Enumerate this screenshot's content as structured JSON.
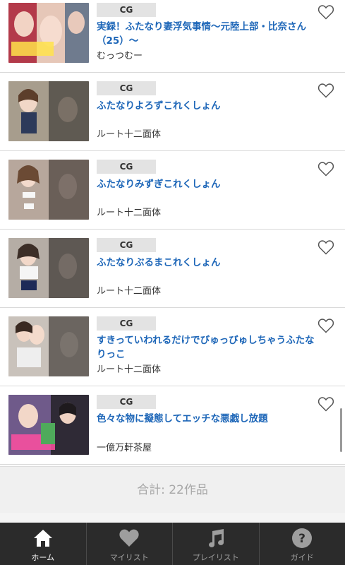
{
  "items": [
    {
      "category": "CG",
      "title": "実録！ふたなり妻浮気事情〜元陸上部・比奈さん（25）〜",
      "circle": "むっつむー"
    },
    {
      "category": "CG",
      "title": "ふたなりよろずこれくしょん",
      "circle": "ルート十二面体"
    },
    {
      "category": "CG",
      "title": "ふたなりみずぎこれくしょん",
      "circle": "ルート十二面体"
    },
    {
      "category": "CG",
      "title": "ふたなりぶるまこれくしょん",
      "circle": "ルート十二面体"
    },
    {
      "category": "CG",
      "title": "すきっていわれるだけでびゅっびゅしちゃうふたなりっこ",
      "circle": "ルート十二面体"
    },
    {
      "category": "CG",
      "title": "色々な物に擬態してエッチな悪戯し放題",
      "circle": "一億万軒茶屋"
    }
  ],
  "total_label": "合計: 22作品",
  "nav": [
    {
      "label": "ホーム",
      "icon": "home-icon",
      "active": true
    },
    {
      "label": "マイリスト",
      "icon": "heart-icon",
      "active": false
    },
    {
      "label": "プレイリスト",
      "icon": "music-note-icon",
      "active": false
    },
    {
      "label": "ガイド",
      "icon": "help-icon",
      "active": false
    }
  ],
  "colors": {
    "title_link": "#1d66b8",
    "nav_bg": "#2b2b2b",
    "badge_bg": "#e3e3e3"
  }
}
